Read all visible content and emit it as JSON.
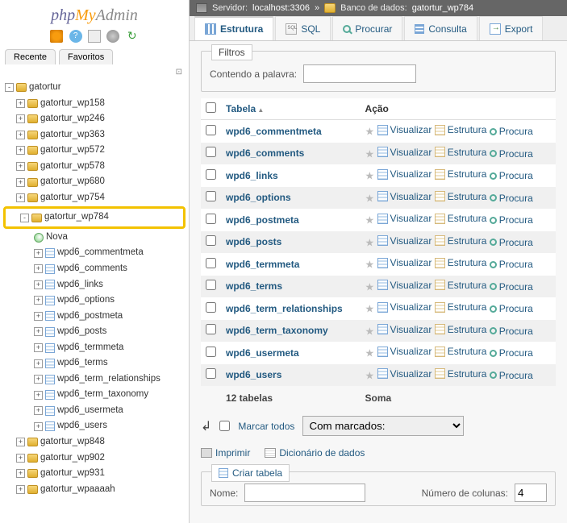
{
  "logo": {
    "php": "php",
    "my": "My",
    "admin": "Admin"
  },
  "side_tabs": {
    "recent": "Recente",
    "favs": "Favoritos"
  },
  "tree": {
    "root": "gatortur",
    "dbs_before": [
      "gatortur_wp158",
      "gatortur_wp246",
      "gatortur_wp363",
      "gatortur_wp572",
      "gatortur_wp578",
      "gatortur_wp680",
      "gatortur_wp754"
    ],
    "selected_db": "gatortur_wp784",
    "nova": "Nova",
    "selected_tables": [
      "wpd6_commentmeta",
      "wpd6_comments",
      "wpd6_links",
      "wpd6_options",
      "wpd6_postmeta",
      "wpd6_posts",
      "wpd6_termmeta",
      "wpd6_terms",
      "wpd6_term_relationships",
      "wpd6_term_taxonomy",
      "wpd6_usermeta",
      "wpd6_users"
    ],
    "dbs_after": [
      "gatortur_wp848",
      "gatortur_wp902",
      "gatortur_wp931",
      "gatortur_wpaaaah"
    ]
  },
  "crumb": {
    "server_label": "Servidor:",
    "server": "localhost:3306",
    "db_label": "Banco de dados:",
    "db": "gatortur_wp784"
  },
  "main_tabs": {
    "structure": "Estrutura",
    "sql": "SQL",
    "search": "Procurar",
    "query": "Consulta",
    "export": "Export"
  },
  "filter": {
    "legend": "Filtros",
    "label": "Contendo a palavra:"
  },
  "table": {
    "th_table": "Tabela",
    "th_action": "Ação",
    "rows": [
      {
        "name": "wpd6_commentmeta"
      },
      {
        "name": "wpd6_comments"
      },
      {
        "name": "wpd6_links"
      },
      {
        "name": "wpd6_options"
      },
      {
        "name": "wpd6_postmeta"
      },
      {
        "name": "wpd6_posts"
      },
      {
        "name": "wpd6_termmeta"
      },
      {
        "name": "wpd6_terms"
      },
      {
        "name": "wpd6_term_relationships"
      },
      {
        "name": "wpd6_term_taxonomy"
      },
      {
        "name": "wpd6_usermeta"
      },
      {
        "name": "wpd6_users"
      }
    ],
    "action_visualize": "Visualizar",
    "action_structure": "Estrutura",
    "action_search": "Procura",
    "footer_count": "12 tabelas",
    "footer_sum": "Soma"
  },
  "bulk": {
    "checkall": "Marcar todos",
    "with_selected": "Com marcados:"
  },
  "links": {
    "print": "Imprimir",
    "dict": "Dicionário de dados"
  },
  "create": {
    "legend": "Criar tabela",
    "name": "Nome:",
    "cols": "Número de colunas:",
    "cols_val": "4"
  }
}
